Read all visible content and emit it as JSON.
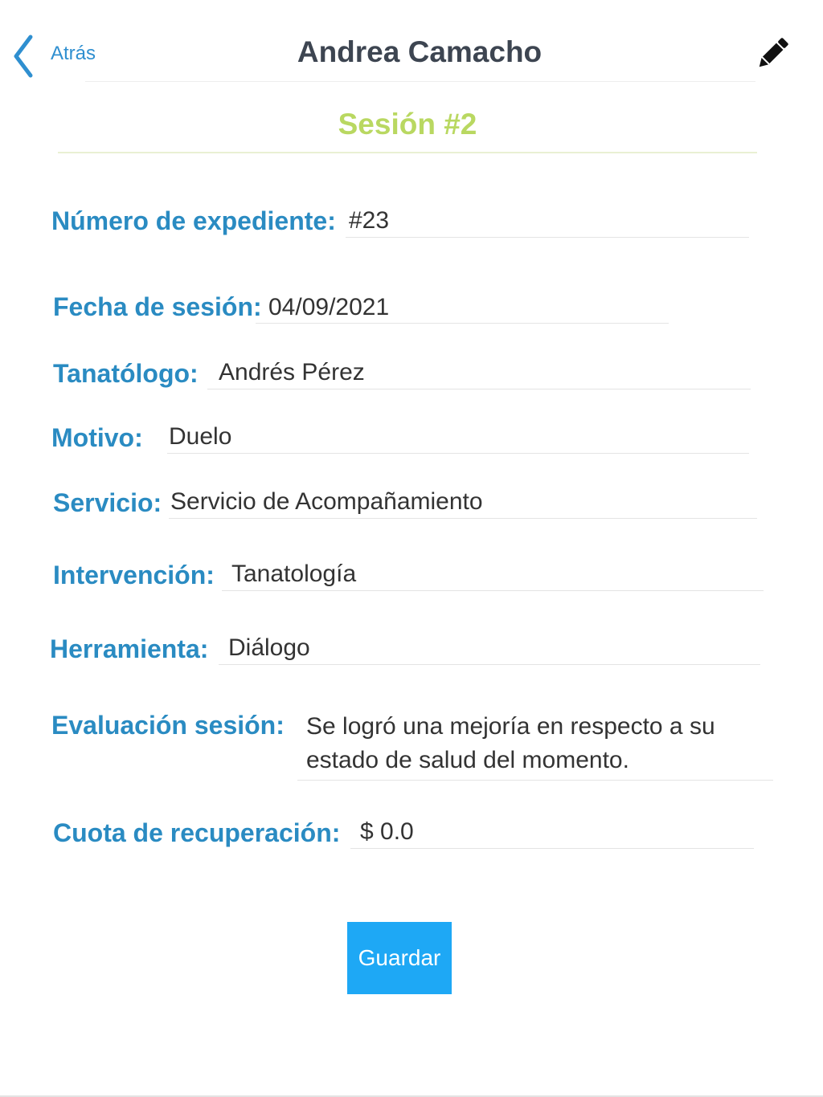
{
  "header": {
    "back_label": "Atrás",
    "title": "Andrea Camacho",
    "back_icon": "chevron-left-icon",
    "edit_icon": "pencil-icon"
  },
  "session": {
    "title": "Sesión #2"
  },
  "fields": {
    "expediente": {
      "label": "Número de expediente:",
      "value": "#23"
    },
    "fecha": {
      "label": "Fecha de sesión:",
      "value": "04/09/2021"
    },
    "tanatologo": {
      "label": "Tanatólogo:",
      "value": "Andrés Pérez"
    },
    "motivo": {
      "label": "Motivo:",
      "value": "Duelo"
    },
    "servicio": {
      "label": "Servicio:",
      "value": "Servicio de Acompañamiento"
    },
    "intervencion": {
      "label": "Intervención:",
      "value": "Tanatología"
    },
    "herramienta": {
      "label": "Herramienta:",
      "value": "Diálogo"
    },
    "evaluacion": {
      "label": "Evaluación sesión:",
      "value": "Se logró una mejoría en respecto a su estado de salud del momento."
    },
    "cuota": {
      "label": "Cuota de recuperación:",
      "value": "$ 0.0"
    }
  },
  "actions": {
    "save_label": "Guardar"
  },
  "colors": {
    "label": "#2a8bc2",
    "title": "#3d4551",
    "subtitle": "#b9d861",
    "button": "#1ea8f5"
  }
}
